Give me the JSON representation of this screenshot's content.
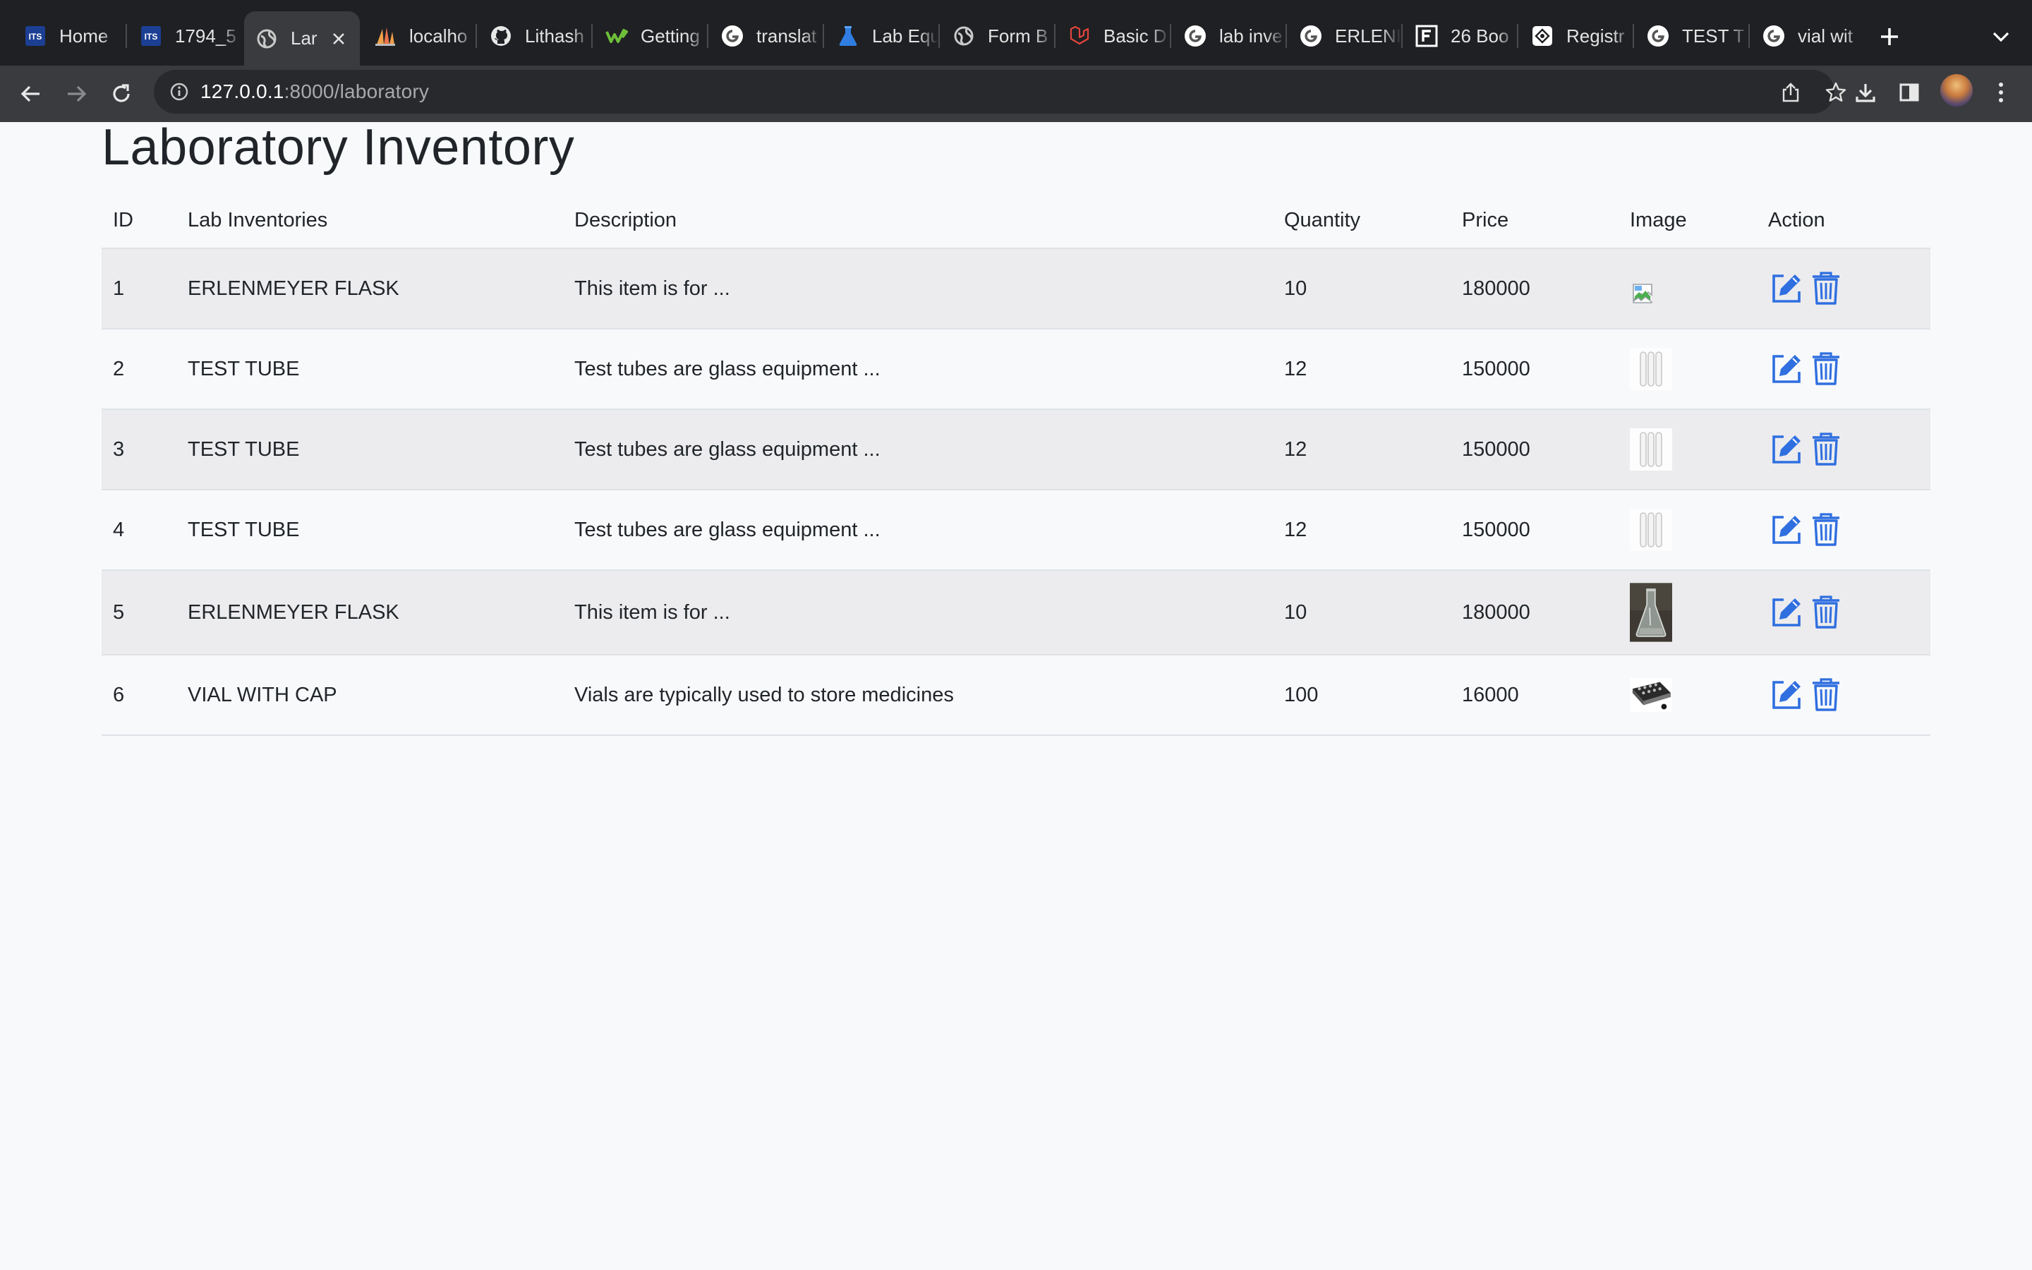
{
  "browser": {
    "tabs": [
      {
        "title": "Home",
        "icon": "its-icon",
        "active": false
      },
      {
        "title": "1794_5",
        "icon": "its-icon",
        "active": false
      },
      {
        "title": "Lar",
        "icon": "globe-icon",
        "active": true
      },
      {
        "title": "localho",
        "icon": "laravel-sail-icon",
        "active": false
      },
      {
        "title": "Lithash",
        "icon": "github-icon",
        "active": false
      },
      {
        "title": "Getting",
        "icon": "w-logo-icon",
        "active": false
      },
      {
        "title": "translat",
        "icon": "google-icon",
        "active": false
      },
      {
        "title": "Lab Equ",
        "icon": "flask-icon",
        "active": false
      },
      {
        "title": "Form B",
        "icon": "globe-icon",
        "active": false
      },
      {
        "title": "Basic D",
        "icon": "laravel-icon",
        "active": false
      },
      {
        "title": "lab inve",
        "icon": "google-icon",
        "active": false
      },
      {
        "title": "ERLENI",
        "icon": "google-icon",
        "active": false
      },
      {
        "title": "26 Boo",
        "icon": "f-square-icon",
        "active": false
      },
      {
        "title": "Registr",
        "icon": "register-icon",
        "active": false
      },
      {
        "title": "TEST T",
        "icon": "google-icon",
        "active": false
      },
      {
        "title": "vial wit",
        "icon": "google-icon",
        "active": false
      }
    ],
    "url_host": "127.0.0.1",
    "url_path": ":8000/laboratory"
  },
  "page": {
    "title": "Laboratory Inventory"
  },
  "table": {
    "headers": {
      "id": "ID",
      "name": "Lab Inventories",
      "description": "Description",
      "quantity": "Quantity",
      "price": "Price",
      "image": "Image",
      "action": "Action"
    },
    "rows": [
      {
        "id": "1",
        "name": "ERLENMEYER FLASK",
        "description": "This item is for ...",
        "quantity": "10",
        "price": "180000",
        "image": "broken-image"
      },
      {
        "id": "2",
        "name": "TEST TUBE",
        "description": "Test tubes are glass equipment ...",
        "quantity": "12",
        "price": "150000",
        "image": "test-tubes"
      },
      {
        "id": "3",
        "name": "TEST TUBE",
        "description": "Test tubes are glass equipment ...",
        "quantity": "12",
        "price": "150000",
        "image": "test-tubes"
      },
      {
        "id": "4",
        "name": "TEST TUBE",
        "description": "Test tubes are glass equipment ...",
        "quantity": "12",
        "price": "150000",
        "image": "test-tubes"
      },
      {
        "id": "5",
        "name": "ERLENMEYER FLASK",
        "description": "This item is for ...",
        "quantity": "10",
        "price": "180000",
        "image": "erlenmeyer-flask-photo"
      },
      {
        "id": "6",
        "name": "VIAL WITH CAP",
        "description": "Vials are typically used to store medicines",
        "quantity": "100",
        "price": "16000",
        "image": "vial-tray-photo"
      }
    ]
  },
  "colors": {
    "action_blue": "#2f6fe0",
    "stripe": "#ececee",
    "page_bg": "#f8f9fb"
  }
}
